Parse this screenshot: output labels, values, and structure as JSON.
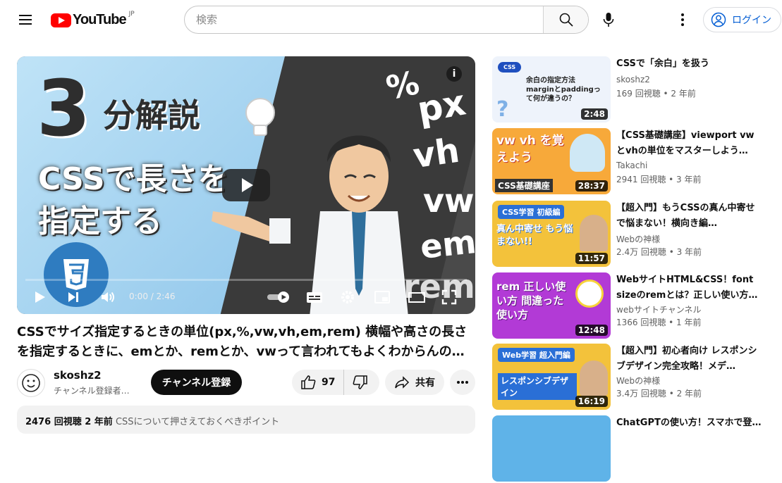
{
  "header": {
    "logo_text": "YouTube",
    "region": "JP",
    "search_placeholder": "検索",
    "login_label": "ログイン"
  },
  "player": {
    "thumb": {
      "big_number": "3",
      "heading": "分解説",
      "line2": "CSSで長さを",
      "line3": "指定する",
      "units": [
        "%",
        "px",
        "vh",
        "vw",
        "em",
        "rem"
      ],
      "badge_text": "CSS"
    },
    "time": "0:00 / 2:46",
    "progress": 0.0
  },
  "video": {
    "title": "CSSでサイズ指定するときの単位(px,%,vw,vh,em,rem) 横幅や高さの長さを指定するときに、emとか、remとか、vwって言われてもよくわからんの…",
    "channel_name": "skoshz2",
    "subs": "チャンネル登録者…",
    "subscribe_label": "チャンネル登録",
    "likes": "97",
    "share_label": "共有",
    "desc_meta": "2476 回視聴  2 年前",
    "desc_tag": "CSSについて押さえておくべきポイント"
  },
  "recommendations": [
    {
      "title": "CSSで「余白」を扱う",
      "channel": "skoshz2",
      "views": "169 回視聴 • 2 年前",
      "duration": "2:48",
      "bg": "#eef3fb",
      "thumb_text": "余白の指定方法 marginとpaddingって何が違うの？"
    },
    {
      "title": "【CSS基礎講座】viewport vwとvhの単位をマスターしよう…",
      "channel": "Takachi",
      "views": "2941 回視聴 • 3 年前",
      "duration": "28:37",
      "bg": "#f7a93a",
      "thumb_text": "vw vh を覚えよう"
    },
    {
      "title": "【超入門】もうCSSの真ん中寄せで悩まない！横向き編…",
      "channel": "Webの神様",
      "views": "2.4万 回視聴 • 3 年前",
      "duration": "11:57",
      "bg": "#f3c23b",
      "thumb_text": "真ん中寄せ もう悩まない!!"
    },
    {
      "title": "WebサイトHTML&CSS！font sizeのremとは？正しい使い方…",
      "channel": "webサイトチャンネル",
      "views": "1366 回視聴 • 1 年前",
      "duration": "12:48",
      "bg": "#b23ad6",
      "thumb_text": "rem 正しい使い方 間違った使い方"
    },
    {
      "title": "【超入門】初心者向け レスポンシブデザイン完全攻略！メデ…",
      "channel": "Webの神様",
      "views": "3.4万 回視聴 • 2 年前",
      "duration": "16:19",
      "bg": "#f3c23b",
      "thumb_text": "レスポンシブデザイン"
    },
    {
      "title": "ChatGPTの使い方！スマホで登…",
      "channel": "",
      "views": "",
      "duration": "",
      "bg": "#5fb3e8",
      "thumb_text": ""
    }
  ]
}
